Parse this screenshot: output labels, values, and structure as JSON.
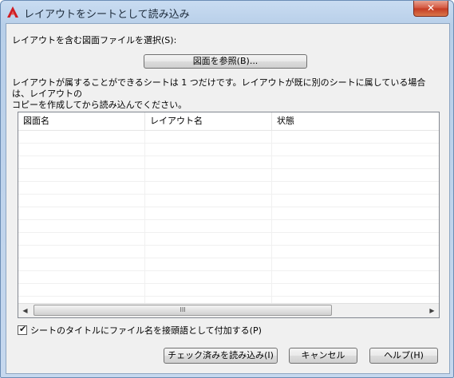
{
  "window": {
    "title": "レイアウトをシートとして読み込み",
    "close_label": "✕",
    "app_icon": "autocad-a-icon",
    "accent": "#cf1d23"
  },
  "main": {
    "select_label": "レイアウトを含む図面ファイルを選択(S):",
    "browse_label": "図面を参照(B)...",
    "note_line1": "レイアウトが属することができるシートは 1 つだけです。レイアウトが既に別のシートに属している場合は、レイアウトの",
    "note_line2": "コピーを作成してから読み込んでください。"
  },
  "table": {
    "columns": [
      "図面名",
      "レイアウト名",
      "状態"
    ],
    "rows": []
  },
  "scrollbar": {
    "left_arrow": "◀",
    "right_arrow": "▶",
    "grip": "III"
  },
  "options": {
    "prefix_checkbox_label": "シートのタイトルにファイル名を接頭語として付加する(P)",
    "prefix_checked": true
  },
  "buttons": {
    "import_checked": "チェック済みを読み込み(I)",
    "cancel": "キャンセル",
    "help": "ヘルプ(H)"
  }
}
